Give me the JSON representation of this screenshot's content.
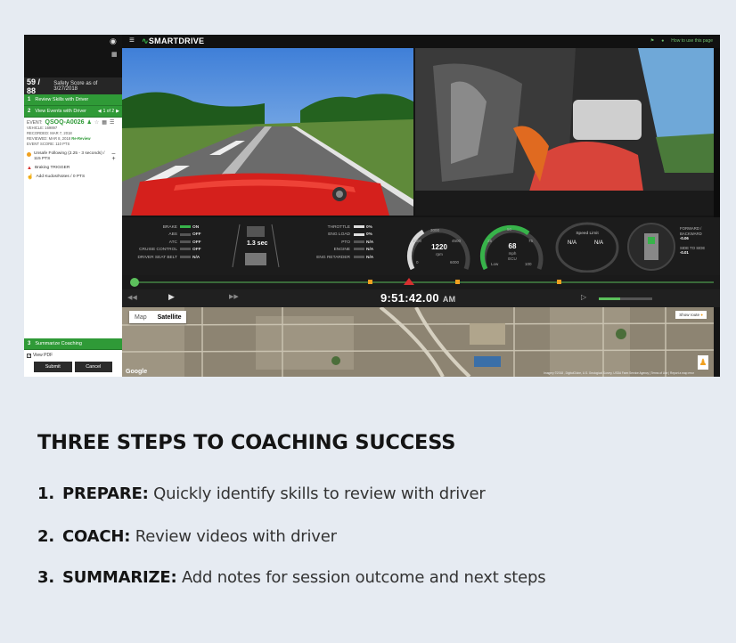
{
  "app": {
    "brand": "SMARTDRIVE",
    "top_right_link": "How to use this page"
  },
  "left_panel": {
    "score_count": "59 / 88",
    "score_caption": "Safety Score as of 3/27/2018",
    "steps": [
      {
        "num": "1",
        "label": "Review Skills with Driver"
      },
      {
        "num": "2",
        "label": "View Events with Driver",
        "pager": "1 of 2"
      },
      {
        "num": "3",
        "label": "Summarize Coaching"
      }
    ],
    "event": {
      "prefix": "EVENT:",
      "id": "QSOQ-A0026",
      "vehicle": "VEHICLE: 169897",
      "recorded": "RECORDED: MAR 7, 2018",
      "reviewed": "REVIEWED: MAR 8, 2018",
      "review_badge": "Re-Review",
      "score": "EVENT SCORE: 110 PTS"
    },
    "items": [
      {
        "label": "Unsafe Following (2.25 - 3 seconds) / 115 PTS",
        "color": "#f0a020"
      },
      {
        "label": "Braking TRIGGER",
        "color": "#d63030"
      },
      {
        "label": "Add Kudos/Notes / 0 PTS",
        "color": "#bbbbbb"
      }
    ],
    "view_pdf": "View PDF",
    "submit": "Submit",
    "cancel": "Cancel"
  },
  "telemetry": {
    "left_labels": [
      "BRAKE",
      "ABS",
      "ATC",
      "CRUISE CONTROL",
      "DRIVER SEAT BELT"
    ],
    "left_values": [
      "ON",
      "OFF",
      "OFF",
      "OFF",
      "N/A"
    ],
    "mid_labels": [
      "THROTTLE",
      "ENG LOAD",
      "PTO",
      "ENGINE",
      "ENG RETARDER"
    ],
    "mid_values": [
      "0%",
      "0%",
      "N/A",
      "N/A",
      "N/A"
    ],
    "following": "1.3 sec",
    "rpm_gauge": {
      "value": "1220",
      "unit": "rpm",
      "ticks": [
        "1000",
        "3000",
        "4500",
        "0",
        "6000"
      ]
    },
    "speed_gauge": {
      "value": "68",
      "unit": "mph",
      "sub": "ECU",
      "ticks": [
        "25",
        "50",
        "75",
        "100",
        "Low"
      ]
    },
    "speed_limit": {
      "label": "Speed Limit",
      "values": [
        "N/A",
        "N/A"
      ]
    },
    "forces": {
      "fwd_label": "FORWARD / BACKWARD",
      "fwd_value": "-0.06",
      "side_label": "SIDE TO SIDE",
      "side_value": "-0.01"
    }
  },
  "player": {
    "time": "9:51:42.00",
    "ampm": "AM",
    "progress": 0.03
  },
  "map": {
    "tab_map": "Map",
    "tab_satellite": "Satellite",
    "show_route": "Show route",
    "provider": "Google",
    "copyright": "Imagery ©2018 , DigitalGlobe, U.S. Geological Survey, USDA Farm Service Agency | Terms of Use | Report a map error"
  },
  "content": {
    "heading": "THREE STEPS TO COACHING SUCCESS",
    "steps": [
      {
        "num": "1.",
        "title": "PREPARE:",
        "text": "Quickly identify skills to review with driver"
      },
      {
        "num": "2.",
        "title": "COACH:",
        "text": "Review videos with driver"
      },
      {
        "num": "3.",
        "title": "SUMMARIZE:",
        "text": "Add notes for session outcome and next steps"
      }
    ]
  },
  "colors": {
    "accent": "#2f9a37",
    "page_bg": "#e6ebf2",
    "dark": "#141414"
  }
}
